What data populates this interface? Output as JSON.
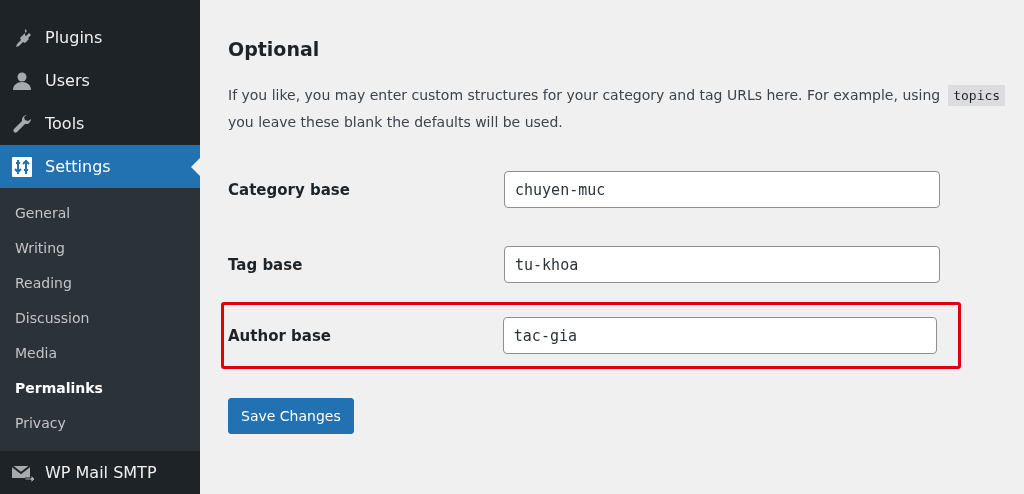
{
  "sidebar": {
    "items": [
      {
        "label": "Plugins",
        "selected": false
      },
      {
        "label": "Users",
        "selected": false
      },
      {
        "label": "Tools",
        "selected": false
      },
      {
        "label": "Settings",
        "selected": true,
        "children": [
          {
            "label": "General",
            "selected": false
          },
          {
            "label": "Writing",
            "selected": false
          },
          {
            "label": "Reading",
            "selected": false
          },
          {
            "label": "Discussion",
            "selected": false
          },
          {
            "label": "Media",
            "selected": false
          },
          {
            "label": "Permalinks",
            "selected": true
          },
          {
            "label": "Privacy",
            "selected": false
          }
        ]
      },
      {
        "label": "WP Mail SMTP",
        "selected": false
      }
    ]
  },
  "section": {
    "title": "Optional",
    "description": {
      "line_1": "If you like, you may enter custom structures for your category and tag URLs here. For example, using",
      "code": "topics",
      "line_2": "you leave these blank the defaults will be used."
    },
    "fields": [
      {
        "label": "Category base",
        "value": "chuyen-muc",
        "highlighted": false
      },
      {
        "label": "Tag base",
        "value": "tu-khoa",
        "highlighted": false
      },
      {
        "label": "Author base",
        "value": "tac-gia",
        "highlighted": true
      }
    ],
    "button": "Save Changes"
  }
}
